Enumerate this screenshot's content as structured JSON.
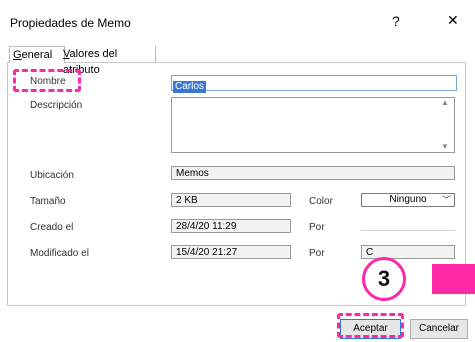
{
  "window": {
    "title": "Propiedades de Memo",
    "help": "?",
    "close": "✕"
  },
  "tabs": [
    {
      "prefix": "",
      "accel": "G",
      "rest": "eneral"
    },
    {
      "prefix": "",
      "accel": "V",
      "rest": "alores del atributo"
    }
  ],
  "form": {
    "name_label": "Nombre",
    "name_value": "Carlos",
    "desc_label": "Descripción",
    "location_label": "Ubicación",
    "location_value": "Memos",
    "size_label": "Tamaño",
    "size_value": "2 KB",
    "color_label": "Color",
    "color_value": "Ninguno",
    "created_label": "Creado el",
    "created_value": "28/4/20 11:29",
    "modified_label": "Modificado el",
    "modified_value": "15/4/20 21:27",
    "by_label": "Por",
    "modified_by_value": "C"
  },
  "buttons": {
    "ok": "Aceptar",
    "cancel": "Cancelar"
  },
  "annotation": {
    "step": "3",
    "color": "#ff29a8"
  }
}
